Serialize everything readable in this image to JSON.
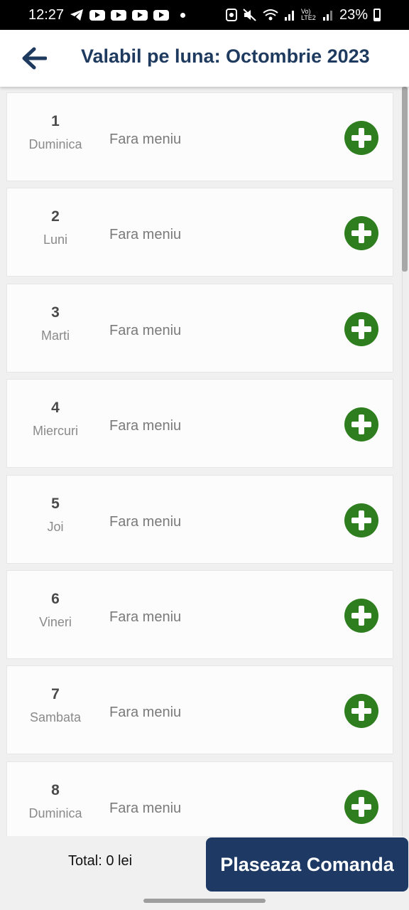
{
  "status_bar": {
    "time": "12:27",
    "lte_label": "Vo) LTE2",
    "battery": "23%"
  },
  "header": {
    "title": "Valabil pe luna: Octombrie 2023"
  },
  "days": [
    {
      "num": "1",
      "name": "Duminica",
      "menu": "Fara meniu"
    },
    {
      "num": "2",
      "name": "Luni",
      "menu": "Fara meniu"
    },
    {
      "num": "3",
      "name": "Marti",
      "menu": "Fara meniu"
    },
    {
      "num": "4",
      "name": "Miercuri",
      "menu": "Fara meniu"
    },
    {
      "num": "5",
      "name": "Joi",
      "menu": "Fara meniu"
    },
    {
      "num": "6",
      "name": "Vineri",
      "menu": "Fara meniu"
    },
    {
      "num": "7",
      "name": "Sambata",
      "menu": "Fara meniu"
    },
    {
      "num": "8",
      "name": "Duminica",
      "menu": "Fara meniu"
    }
  ],
  "footer": {
    "total": "Total: 0 lei",
    "order_button": "Plaseaza Comanda"
  },
  "colors": {
    "primary": "#1e3a64",
    "add_green": "#2e7d1e"
  }
}
